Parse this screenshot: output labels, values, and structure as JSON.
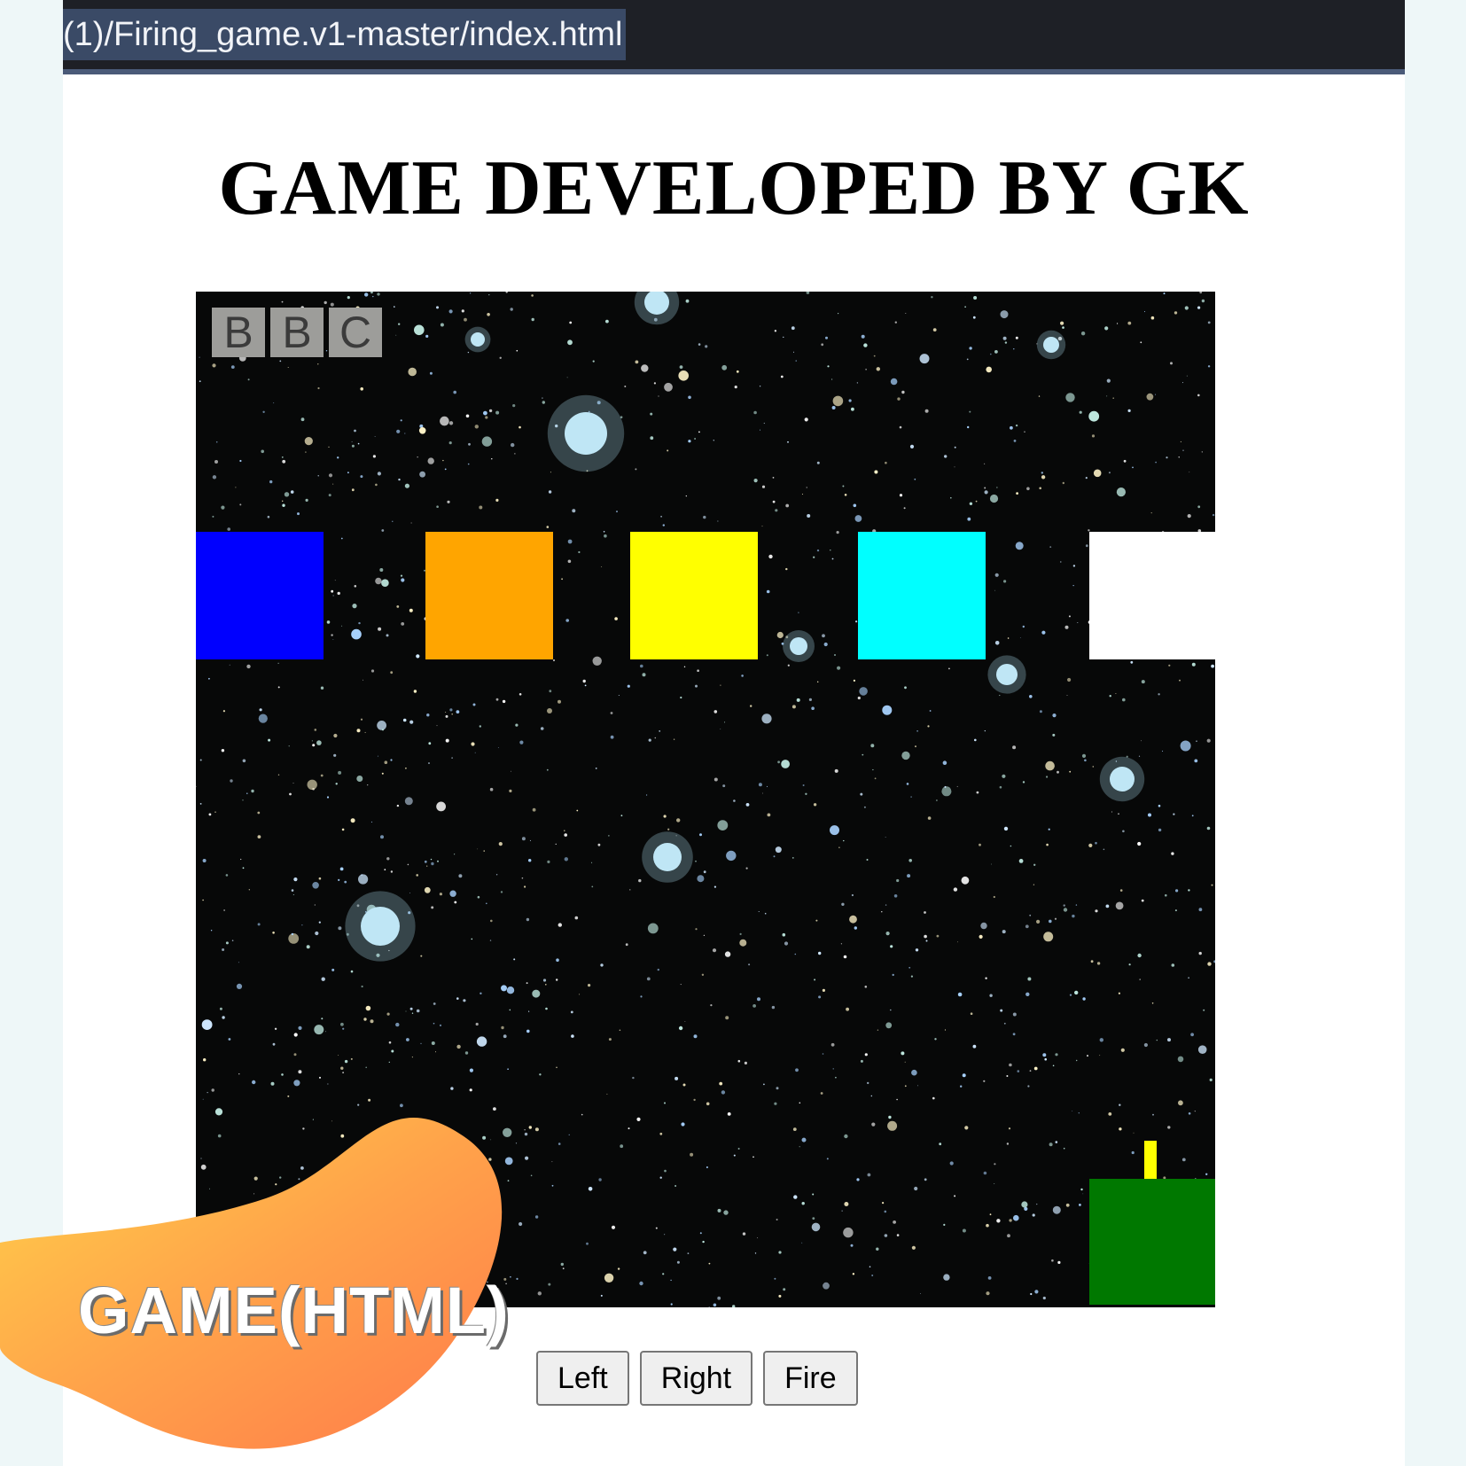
{
  "browser": {
    "url": "(1)/Firing_game.v1-master/index.html"
  },
  "page": {
    "title": "GAME DEVELOPED BY GK"
  },
  "game": {
    "background": "starfield",
    "watermark": [
      "B",
      "B",
      "C"
    ],
    "targets": [
      {
        "color": "#0000ff"
      },
      {
        "color": "#ffa500"
      },
      {
        "color": "#ffff00"
      },
      {
        "color": "#00ffff"
      },
      {
        "color": "#ffffff"
      }
    ],
    "player_color": "#007800",
    "bullet_color": "#ffff00"
  },
  "controls": {
    "left_label": "Left",
    "right_label": "Right",
    "fire_label": "Fire"
  },
  "overlay": {
    "badge_text": "GAME(HTML)"
  }
}
